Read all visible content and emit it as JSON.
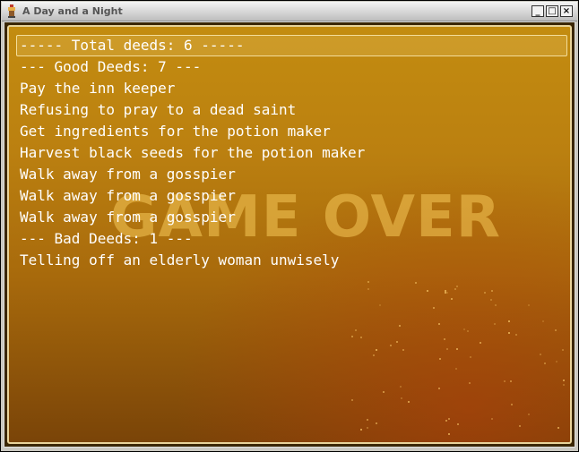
{
  "window": {
    "title": "A Day and a Night",
    "minimize_glyph": "_",
    "maximize_glyph": "□",
    "close_glyph": "×"
  },
  "overlay": {
    "text": "GAME OVER"
  },
  "summary": {
    "lines": [
      "----- Total deeds: 6 -----",
      "--- Good Deeds: 7 ---",
      "Pay the inn keeper",
      "Refusing to pray to a dead saint",
      "Get ingredients for the potion maker",
      "Harvest black seeds for the potion maker",
      "Walk away from a gosspier",
      "Walk away from a gosspier",
      "Walk away from a gosspier",
      "--- Bad Deeds: 1 ---",
      "Telling off an elderly woman unwisely"
    ]
  },
  "colors": {
    "background_top": "#c38c10",
    "background_bottom": "#7a4408",
    "text": "#ffffff",
    "overlay_text": "#f5c85a"
  }
}
